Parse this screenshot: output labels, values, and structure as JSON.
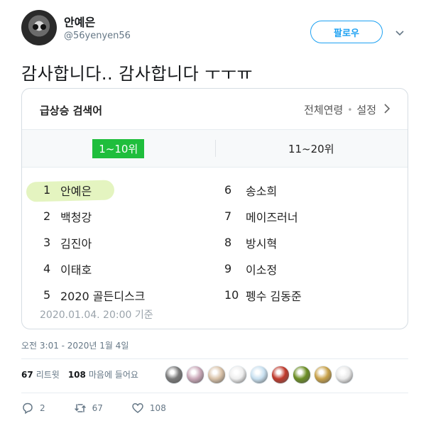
{
  "user": {
    "name": "안예은",
    "handle": "@56yenyen56"
  },
  "follow_label": "팔로우",
  "tweet_text": "감사합니다.. 감사합니다 ㅜㅜㅠ",
  "card": {
    "title": "급상승 검색어",
    "opt_age": "전체연령",
    "opt_settings": "설정",
    "tabs": [
      "1~10위",
      "11~20위"
    ],
    "ranks_left": [
      {
        "num": "1",
        "label": "안예은"
      },
      {
        "num": "2",
        "label": "백청강"
      },
      {
        "num": "3",
        "label": "김진아"
      },
      {
        "num": "4",
        "label": "이태호"
      },
      {
        "num": "5",
        "label": "2020 골든디스크"
      }
    ],
    "ranks_right": [
      {
        "num": "6",
        "label": "송소희"
      },
      {
        "num": "7",
        "label": "메이즈러너"
      },
      {
        "num": "8",
        "label": "방시혁"
      },
      {
        "num": "9",
        "label": "이소정"
      },
      {
        "num": "10",
        "label": "펭수 김동준"
      }
    ],
    "timestamp": "2020.01.04. 20:00 기준"
  },
  "tweet_time": "오전 3:01 - 2020년 1월 4일",
  "stats": {
    "retweets": "67",
    "retweets_label": "리트윗",
    "likes": "108",
    "likes_label": "마음에 들어요"
  },
  "likers": [
    "#7a7a7a",
    "#caa8b8",
    "#d9c2a8",
    "#eeeeee",
    "#c8e0f0",
    "#c0392b",
    "#6b8e23",
    "#c9a24a",
    "#e9e9e9"
  ],
  "actions": {
    "reply": "2",
    "retweet": "67",
    "like": "108"
  },
  "colors": {
    "accent": "#1da1f2",
    "tab_active": "#1fbe3c",
    "highlight": "#cdeb8c"
  }
}
